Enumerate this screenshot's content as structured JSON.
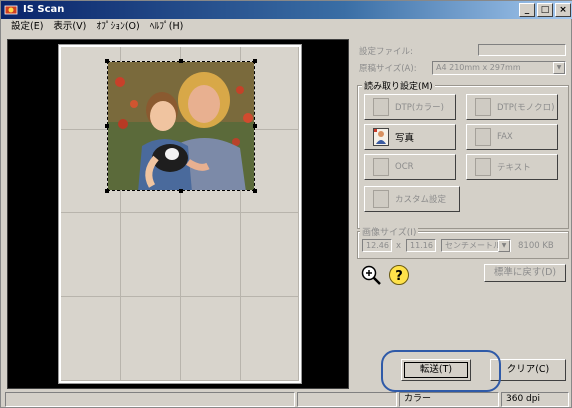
{
  "window": {
    "title": "IS Scan",
    "buttons": [
      "_",
      "□",
      "×"
    ]
  },
  "menu": [
    "設定(E)",
    "表示(V)",
    "ｵﾌﾟｼｮﾝ(O)",
    "ﾍﾙﾌﾟ(H)"
  ],
  "settings": {
    "file_label": "設定ファイル:",
    "file_value": "",
    "paper_label": "原稿サイズ(A):",
    "paper_value": "A4 210mm x 297mm"
  },
  "scan_mode": {
    "title": "読み取り設定(M)",
    "buttons": [
      {
        "label": "DTP(カラー)",
        "enabled": false
      },
      {
        "label": "DTP(モノクロ)",
        "enabled": false
      },
      {
        "label": "写真",
        "enabled": true,
        "active": true
      },
      {
        "label": "FAX",
        "enabled": false
      },
      {
        "label": "OCR",
        "enabled": false
      },
      {
        "label": "テキスト",
        "enabled": false
      },
      {
        "label": "カスタム設定",
        "enabled": false
      }
    ]
  },
  "image_size": {
    "title": "画像サイズ(I)",
    "width": "12.46",
    "times": "x",
    "height": "11.16",
    "unit": "センチメートル",
    "filesize": "8100 KB"
  },
  "actions": {
    "reset_label": "標準に戻す(D)",
    "transfer_label": "転送(T)",
    "clear_label": "クリア(C)"
  },
  "status": {
    "color_mode": "カラー",
    "resolution": "360 dpi"
  },
  "colors": {
    "accent_ring": "#2f5aa8",
    "titlebar": "#0a246a"
  }
}
